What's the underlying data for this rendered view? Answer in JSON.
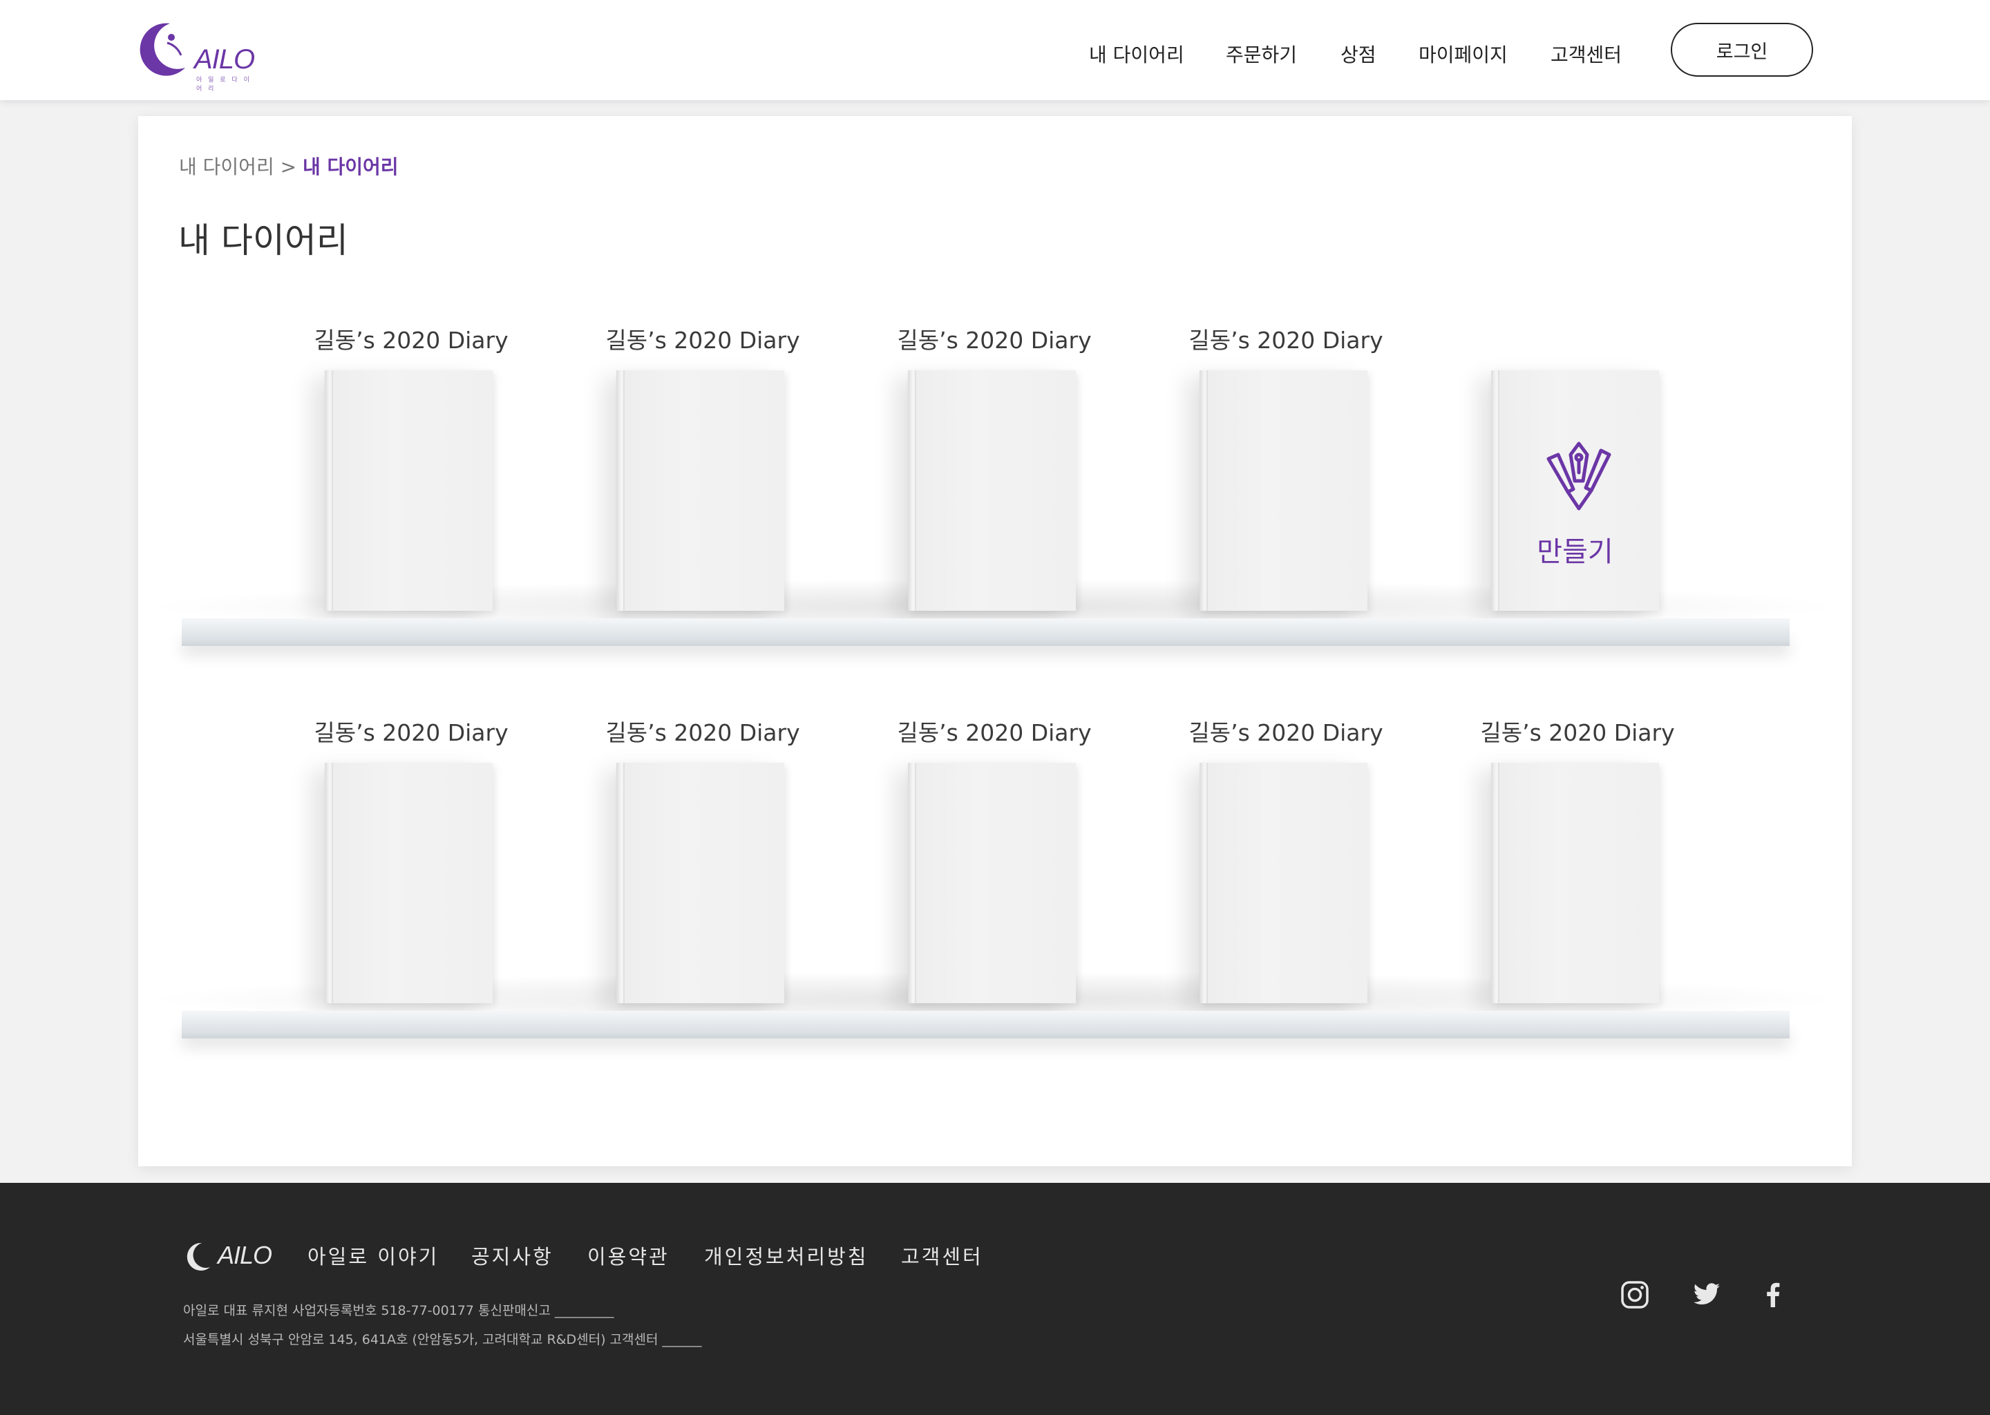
{
  "header": {
    "logo_text": "AILO",
    "logo_sub": "아 일 로 다 이 어 리",
    "nav": [
      "내 다이어리",
      "주문하기",
      "상점",
      "마이페이지",
      "고객센터"
    ],
    "login_label": "로그인"
  },
  "main": {
    "breadcrumb": {
      "parent": "내 다이어리 >",
      "current": "내 다이어리"
    },
    "title": "내 다이어리",
    "shelves": [
      {
        "diaries": [
          {
            "title": "길동’s 2020 Diary"
          },
          {
            "title": "길동’s 2020 Diary"
          },
          {
            "title": "길동’s 2020 Diary"
          },
          {
            "title": "길동’s 2020 Diary"
          }
        ],
        "create_label": "만들기"
      },
      {
        "diaries": [
          {
            "title": "길동’s 2020 Diary"
          },
          {
            "title": "길동’s 2020 Diary"
          },
          {
            "title": "길동’s 2020 Diary"
          },
          {
            "title": "길동’s 2020 Diary"
          },
          {
            "title": "길동’s 2020 Diary"
          }
        ]
      }
    ]
  },
  "footer": {
    "logo_text": "AILO",
    "nav": [
      "아일로 이야기",
      "공지사항",
      "이용약관",
      "개인정보처리방침",
      "고객센터"
    ],
    "info_line1": "아일로 대표 류지현 사업자등록번호 518-77-00177 통신판매신고 _________",
    "info_line2": "서울특별시 성북구 안암로 145, 641A호 (안암동5가, 고려대학교 R&D센터) 고객센터 ______",
    "social_icons": [
      "instagram-icon",
      "twitter-icon",
      "facebook-icon"
    ]
  },
  "colors": {
    "accent": "#6b36a6",
    "footer_bg": "#272727"
  }
}
